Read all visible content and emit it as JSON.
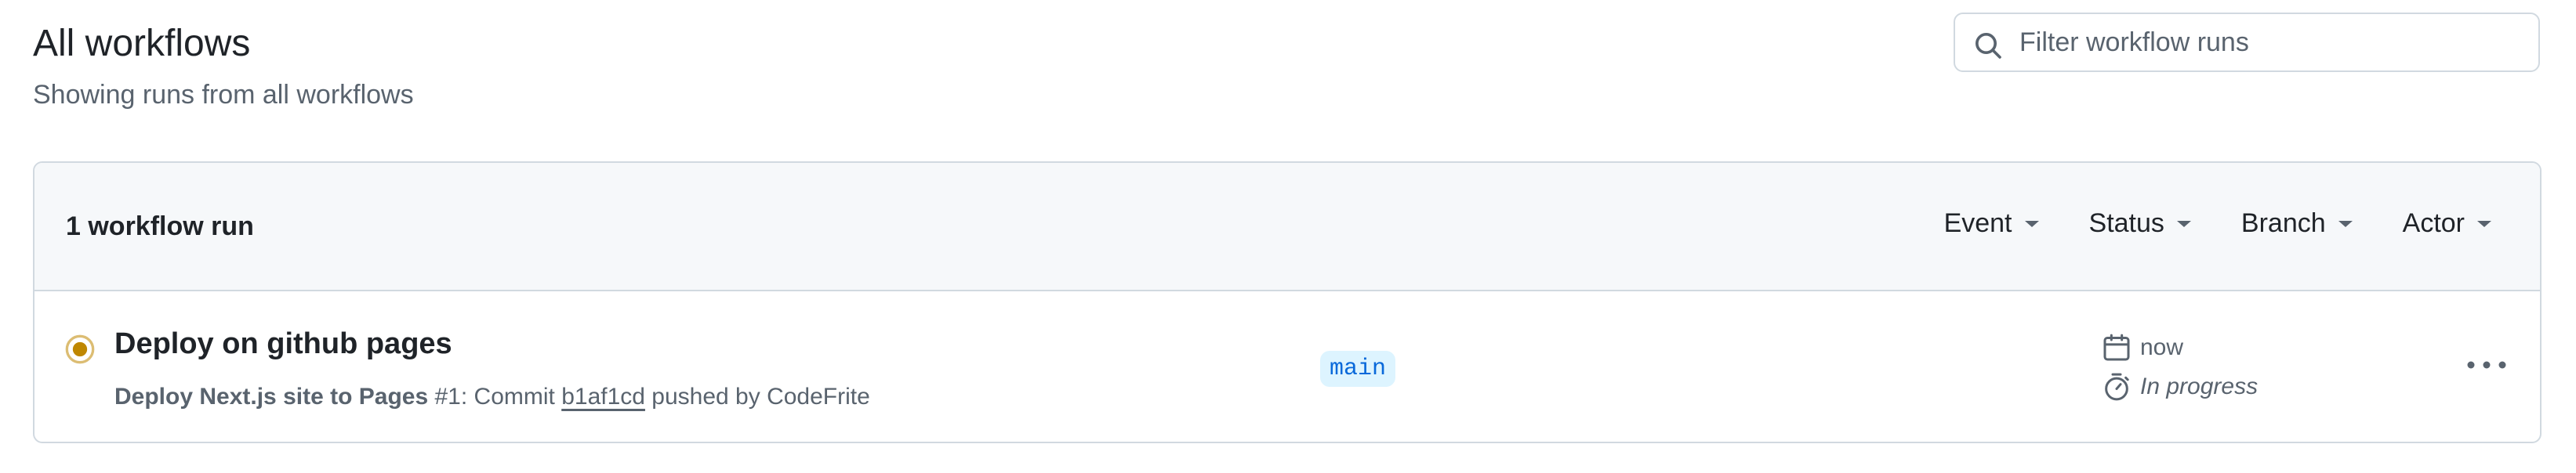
{
  "header": {
    "title": "All workflows",
    "subtitle": "Showing runs from all workflows"
  },
  "search": {
    "placeholder": "Filter workflow runs",
    "icon": "search-icon"
  },
  "runs_box": {
    "count_label": "1 workflow run",
    "filters": [
      {
        "label": "Event"
      },
      {
        "label": "Status"
      },
      {
        "label": "Branch"
      },
      {
        "label": "Actor"
      }
    ],
    "runs": [
      {
        "title": "Deploy on github pages",
        "workflow_name": "Deploy Next.js site to Pages",
        "run_number": "#1",
        "meta_prefix": ": Commit ",
        "commit": "b1af1cd",
        "meta_suffix": " pushed by CodeFrite",
        "branch": "main",
        "time": "now",
        "duration": "In progress",
        "status": "in-progress"
      }
    ]
  },
  "colors": {
    "in_progress": "#bf8700",
    "branch_bg": "#ddf4ff",
    "branch_fg": "#0969da"
  }
}
